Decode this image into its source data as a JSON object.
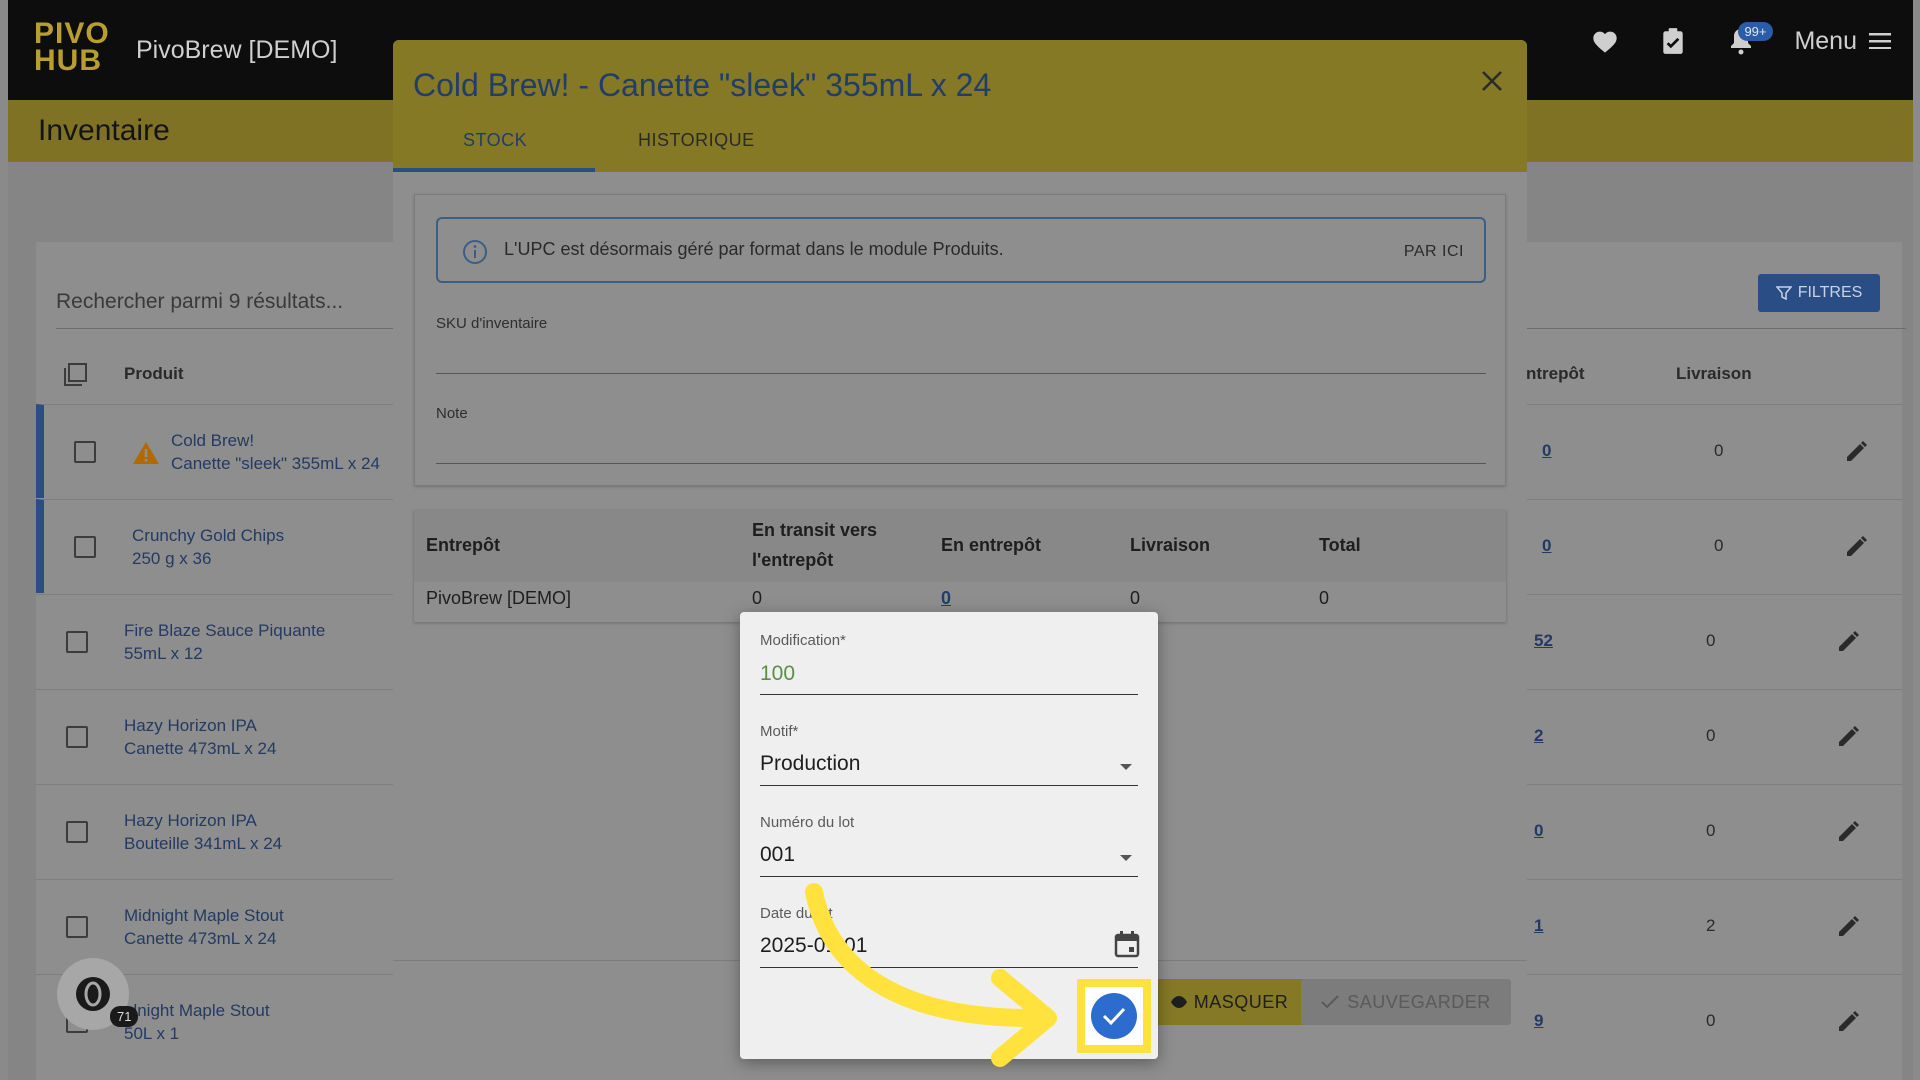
{
  "app": {
    "brand": "PIVO HUB",
    "title": "PivoBrew [DEMO]",
    "notifications_badge": "99+",
    "menu_label": "Menu"
  },
  "page": {
    "heading": "Inventaire",
    "search_placeholder": "Rechercher parmi 9 résultats...",
    "filters_label": "FILTRES",
    "columns": {
      "product": "Produit",
      "entrepot": "ntrepôt",
      "livraison": "Livraison"
    },
    "rows": [
      {
        "name": "Cold Brew!",
        "sub": "Canette \"sleek\" 355mL x 24",
        "entrepot": "0",
        "livraison": "0",
        "warning": true
      },
      {
        "name": "Crunchy Gold Chips",
        "sub": "250 g x 36",
        "entrepot": "0",
        "livraison": "0",
        "warning": false
      },
      {
        "name": "Fire Blaze Sauce Piquante",
        "sub": "55mL x 12",
        "entrepot": "52",
        "livraison": "0",
        "warning": false
      },
      {
        "name": "Hazy Horizon IPA",
        "sub": "Canette 473mL x 24",
        "entrepot": "2",
        "livraison": "0",
        "warning": false
      },
      {
        "name": "Hazy Horizon IPA",
        "sub": "Bouteille 341mL x 24",
        "entrepot": "0",
        "livraison": "0",
        "warning": false
      },
      {
        "name": "Midnight Maple Stout",
        "sub": "Canette 473mL x 24",
        "entrepot": "1",
        "livraison": "2",
        "warning": false
      },
      {
        "name": "idnight Maple Stout",
        "sub": "50L x 1",
        "entrepot": "9",
        "livraison": "0",
        "warning": false
      }
    ],
    "chat_count": "71"
  },
  "modal": {
    "title": "Cold Brew! - Canette \"sleek\" 355mL x 24",
    "tabs": [
      "STOCK",
      "HISTORIQUE"
    ],
    "info_text": "L'UPC est désormais géré par format dans le module Produits.",
    "info_link": "PAR ICI",
    "sku_label": "SKU d'inventaire",
    "note_label": "Note",
    "table": {
      "headers": [
        "Entrepôt",
        "En transit vers",
        "l'entrepôt",
        "En entrepôt",
        "Livraison",
        "Total"
      ],
      "row": [
        "PivoBrew [DEMO]",
        "0",
        "0",
        "0",
        "0"
      ]
    },
    "hide_label": "MASQUER",
    "save_label": "SAUVEGARDER"
  },
  "popover": {
    "modification_label": "Modification*",
    "modification_value": "100",
    "motif_label": "Motif*",
    "motif_value": "Production",
    "lot_label": "Numéro du lot",
    "lot_value": "001",
    "date_label": "Date du lot",
    "date_value": "2025-01-01"
  },
  "colors": {
    "accent": "#2d6ccf",
    "highlight": "#ffe23d",
    "brand": "#b89e2c"
  }
}
